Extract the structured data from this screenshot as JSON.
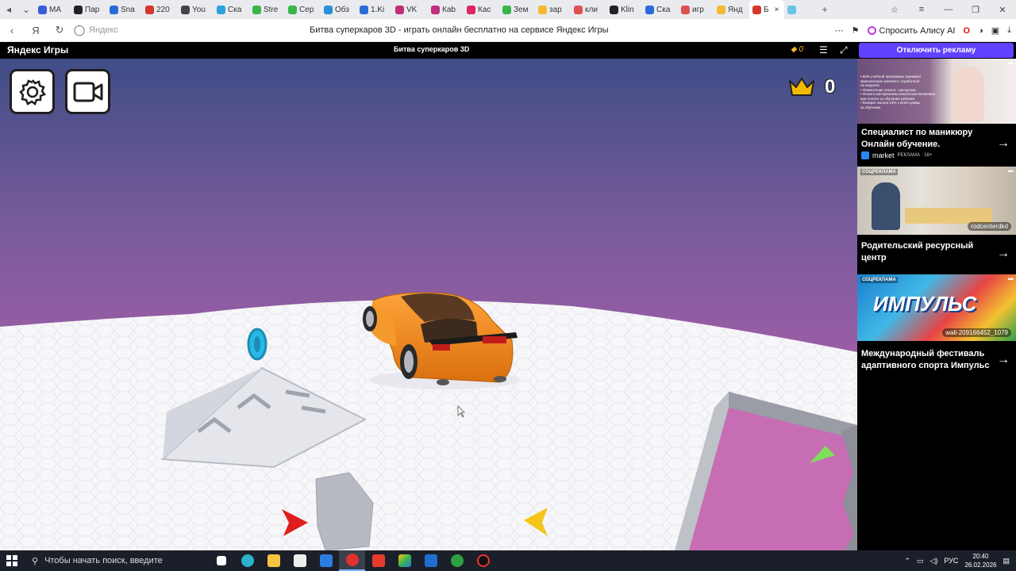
{
  "tabs": [
    {
      "label": "MA",
      "color": "#3b5bd9"
    },
    {
      "label": "Пар",
      "color": "#222"
    },
    {
      "label": "Sna",
      "color": "#2a6ad9"
    },
    {
      "label": "220",
      "color": "#d13a2a"
    },
    {
      "label": "You",
      "color": "#444"
    },
    {
      "label": "Ска",
      "color": "#2aa3d9"
    },
    {
      "label": "Stre",
      "color": "#39b54a"
    },
    {
      "label": "Сер",
      "color": "#39b54a"
    },
    {
      "label": "Обз",
      "color": "#2a8fd9"
    },
    {
      "label": "1.Ki",
      "color": "#2a6ad9"
    },
    {
      "label": "VK",
      "color": "#c02e7a"
    },
    {
      "label": "Кab",
      "color": "#c02e7a"
    },
    {
      "label": "Кас",
      "color": "#e0245e"
    },
    {
      "label": "Зем",
      "color": "#39b54a"
    },
    {
      "label": "зар",
      "color": "#f5b82e"
    },
    {
      "label": "кли",
      "color": "#e05050"
    },
    {
      "label": "Klin",
      "color": "#222"
    },
    {
      "label": "Ска",
      "color": "#2a6ad9"
    },
    {
      "label": "игр",
      "color": "#e05050"
    },
    {
      "label": "Янд",
      "color": "#f5b82e"
    }
  ],
  "active_tab": {
    "label": "Б",
    "close": "×"
  },
  "address": {
    "host": "Яндекс",
    "page_title": "Битва суперкаров 3D - играть онлайн бесплатно на сервисе Яндекс Игры",
    "alice_label": "Спросить Алису AI"
  },
  "yandex_header": {
    "logo": "Яндекс Игры",
    "game_title": "Битва суперкаров 3D",
    "coins": "0",
    "no_ads": "Отключить рекламу"
  },
  "game": {
    "score": "0"
  },
  "ads": [
    {
      "title": "Специалист по маникюру Онлайн обучение.",
      "source": "market",
      "label": "РЕКЛАМА · 16+",
      "img_lines": [
        "• 80% учебной программы занимают",
        "практические занятия с отработкой",
        "на моделях",
        "• Помесячная оплата - рассрочка",
        "• Оплата материнским капиталом! Возможна",
        "при оплате за обучение ребенка",
        "• Возврат налога 13% с всей суммы",
        "за обучение"
      ]
    },
    {
      "tag": "СОЦРЕКЛАМА",
      "title": "Родительский ресурсный центр",
      "source": "rodcenterdkd"
    },
    {
      "tag": "СОЦРЕКЛАМА",
      "title": "Международный фестиваль адаптивного спорта Импульс",
      "source": "wall-209166452_1079",
      "banner": "ИМПУЛЬС"
    }
  ],
  "taskbar": {
    "search_placeholder": "Чтобы начать поиск, введите",
    "lang": "РУС",
    "time": "20:40",
    "date": "26.02.2026"
  },
  "colors": {
    "sky_top": "#3f4d86",
    "sky_mid": "#b05aa8",
    "floor": "#f7f7f9",
    "car": "#f08a1c",
    "accent": "#6140ff"
  }
}
